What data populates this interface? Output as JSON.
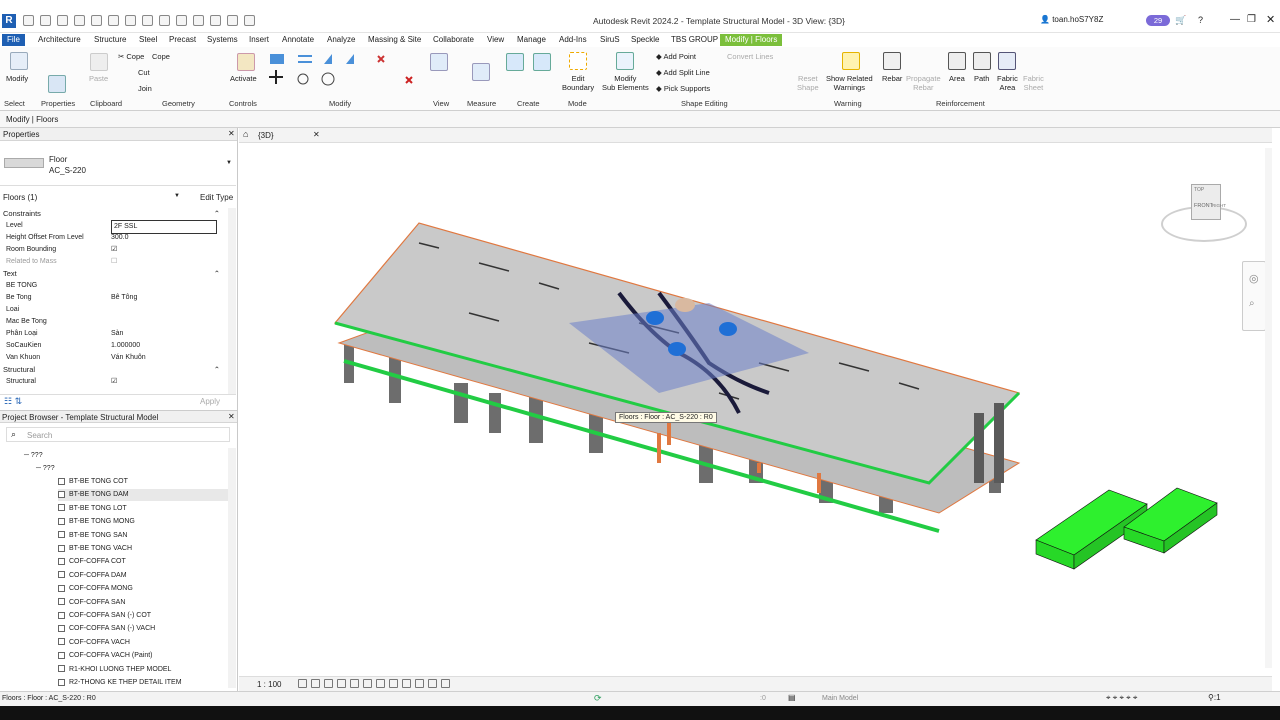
{
  "title": "Autodesk Revit 2024.2 - Template Structural Model - 3D View: {3D}",
  "user": "toan.hoS7Y8Z",
  "badge": "29",
  "tabs": [
    "File",
    "Architecture",
    "Structure",
    "Steel",
    "Precast",
    "Systems",
    "Insert",
    "Annotate",
    "Analyze",
    "Massing & Site",
    "Collaborate",
    "View",
    "Manage",
    "Add-Ins",
    "SiruS",
    "Speckle",
    "TBS GROUP",
    "Modify | Floors"
  ],
  "ribbon": {
    "modify": "Modify",
    "paste": "Paste",
    "cope": "Cope",
    "cut": "Cut",
    "join": "Join",
    "activate": "Activate",
    "edit_boundary": [
      "Edit",
      "Boundary"
    ],
    "modify_sub": [
      "Modify",
      "Sub Elements"
    ],
    "add_point": "Add Point",
    "add_split_line": "Add Split Line",
    "pick_supports": "Pick Supports",
    "convert_lines": "Convert Lines",
    "reset_shape": [
      "Reset",
      "Shape"
    ],
    "show_related": [
      "Show Related",
      "Warnings"
    ],
    "rebar": "Rebar",
    "propagate": [
      "Propagate",
      "Rebar"
    ],
    "area": "Area",
    "path": "Path",
    "fabric_area": [
      "Fabric",
      "Area"
    ],
    "fabric_sheet": [
      "Fabric",
      "Sheet"
    ],
    "panels": [
      "Select",
      "Properties",
      "Clipboard",
      "Geometry",
      "Controls",
      "Modify",
      "View",
      "Measure",
      "Create",
      "Mode",
      "Shape Editing",
      "Warning",
      "Reinforcement"
    ]
  },
  "context_label": "Modify | Floors",
  "properties": {
    "title": "Properties",
    "type_family": "Floor",
    "type_name": "AC_S-220",
    "selector": "Floors (1)",
    "edit_type": "Edit Type",
    "groups": [
      {
        "name": "Constraints",
        "rows": [
          [
            "Level",
            "2F SSL"
          ],
          [
            "Height Offset From Level",
            "300.0"
          ],
          [
            "Room Bounding",
            "☑"
          ],
          [
            "Related to Mass",
            "☐"
          ]
        ]
      },
      {
        "name": "Text",
        "rows": [
          [
            "BE TONG",
            ""
          ],
          [
            "Be Tong",
            "Bê Tông"
          ],
          [
            "Loai",
            ""
          ],
          [
            "Mac Be Tong",
            ""
          ],
          [
            "Phân Loại",
            "Sàn"
          ],
          [
            "SoCauKien",
            "1.000000"
          ],
          [
            "Van Khuon",
            "Ván Khuôn"
          ]
        ]
      },
      {
        "name": "Structural",
        "rows": [
          [
            "Structural",
            "☑"
          ]
        ]
      }
    ],
    "apply": "Apply"
  },
  "browser": {
    "title": "Project Browser - Template Structural Model",
    "search": "Search",
    "root": "???",
    "sub": "???",
    "items": [
      "BT-BE TONG COT",
      "BT-BE TONG DAM",
      "BT-BE TONG LOT",
      "BT-BE TONG MONG",
      "BT-BE TONG SAN",
      "BT-BE TONG VACH",
      "COF-COFFA COT",
      "COF-COFFA DAM",
      "COF-COFFA MONG",
      "COF-COFFA SAN",
      "COF-COFFA SAN (-) COT",
      "COF-COFFA SAN (-) VACH",
      "COF-COFFA VACH",
      "COF-COFFA VACH (Paint)",
      "R1-KHOI LUONG THEP MODEL",
      "R2-THONG KE THEP DETAIL ITEM"
    ]
  },
  "view": {
    "tab": "{3D}",
    "scale": "1 : 100",
    "tooltip": "Floors : Floor : AC_S-220 : R0",
    "cube_top": "TOP",
    "cube_front": "FRONT",
    "cube_right": "RIGHT"
  },
  "status": {
    "text": "Floors : Floor : AC_S-220 : R0",
    "model": "Main Model",
    "zero": ":0",
    "filter": ":1"
  },
  "colors": {
    "accent": "#1e5fb3",
    "context": "#7bbf3b",
    "slab": "#c9c9c9",
    "edge": "#e07840",
    "beam": "#22cc44",
    "mass": "#2ef02e"
  }
}
